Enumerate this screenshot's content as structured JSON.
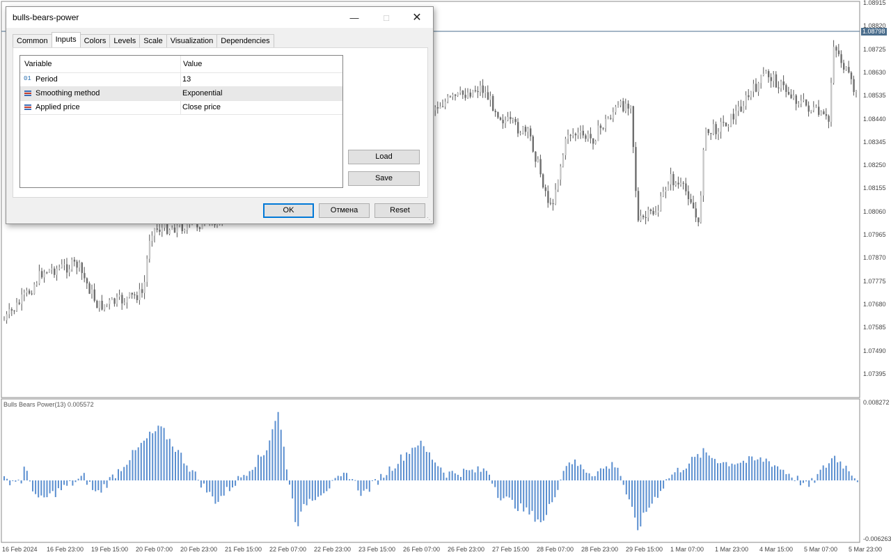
{
  "dialog": {
    "title": "bulls-bears-power",
    "tabs": [
      "Common",
      "Inputs",
      "Colors",
      "Levels",
      "Scale",
      "Visualization",
      "Dependencies"
    ],
    "active_tab": "Inputs",
    "grid": {
      "headers": [
        "Variable",
        "Value"
      ],
      "rows": [
        {
          "variable": "Period",
          "value": "13",
          "icon": "integer-icon"
        },
        {
          "variable": "Smoothing method",
          "value": "Exponential",
          "icon": "enum-icon"
        },
        {
          "variable": "Applied price",
          "value": "Close price",
          "icon": "enum-icon"
        }
      ]
    },
    "side_buttons": {
      "load": "Load",
      "save": "Save"
    },
    "footer_buttons": {
      "ok": "OK",
      "cancel": "Отмена",
      "reset": "Reset"
    }
  },
  "chart": {
    "price_labels": [
      "1.08915",
      "1.08820",
      "1.08725",
      "1.08630",
      "1.08535",
      "1.08440",
      "1.08345",
      "1.08250",
      "1.08155",
      "1.08060",
      "1.07965",
      "1.07870",
      "1.07775",
      "1.07680",
      "1.07585",
      "1.07490",
      "1.07395"
    ],
    "current_price": "1.08798",
    "indicator_label": "Bulls Bears Power(13) 0.005572",
    "indicator_max": "0.008272",
    "indicator_min": "-0.006263",
    "time_labels": [
      "16 Feb 2024",
      "16 Feb 23:00",
      "19 Feb 15:00",
      "20 Feb 07:00",
      "20 Feb 23:00",
      "21 Feb 15:00",
      "22 Feb 07:00",
      "22 Feb 23:00",
      "23 Feb 15:00",
      "26 Feb 07:00",
      "26 Feb 23:00",
      "27 Feb 15:00",
      "28 Feb 07:00",
      "28 Feb 23:00",
      "29 Feb 15:00",
      "1 Mar 07:00",
      "1 Mar 23:00",
      "4 Mar 15:00",
      "5 Mar 07:00",
      "5 Mar 23:00"
    ],
    "colors": {
      "bull": "#c8c8c8",
      "bear": "#6e6e6e",
      "histogram": "#5b8fd0",
      "current_line": "#4a6d8c"
    }
  }
}
